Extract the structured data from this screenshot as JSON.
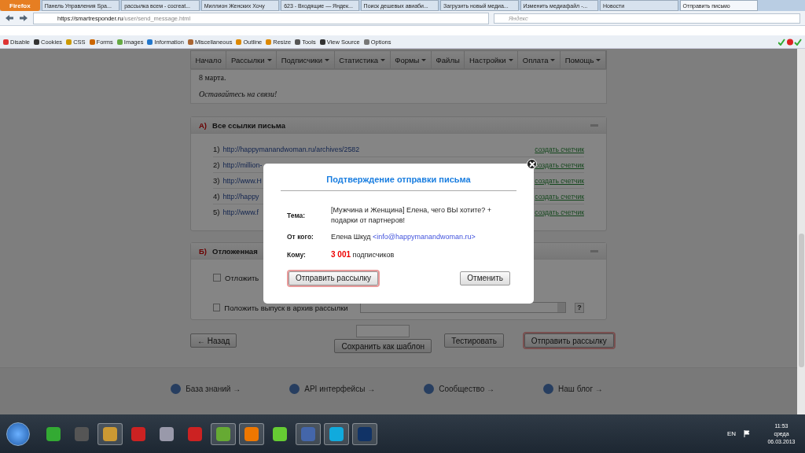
{
  "browser": {
    "menu_button": "Firefox",
    "tabs": [
      {
        "label": "Панель Управления Spa...",
        "selected": false
      },
      {
        "label": "рассылка всем - cocreat...",
        "selected": false
      },
      {
        "label": "Миллион Женских Хочу",
        "selected": false
      },
      {
        "label": "623 - Входящие — Яндек...",
        "selected": false
      },
      {
        "label": "Поиск дешевых авиаби...",
        "selected": false
      },
      {
        "label": "Загрузить новый медиа...",
        "selected": false
      },
      {
        "label": "Изменить медиафайл -...",
        "selected": false
      },
      {
        "label": "Новости",
        "selected": false
      },
      {
        "label": "Отправить письмо",
        "selected": true
      }
    ],
    "url_host": "https://smartresponder.ru",
    "url_path": "/user/send_message.html",
    "search": {
      "placeholder": "Яндекс"
    },
    "toolbar": [
      "Disable",
      "Cookies",
      "CSS",
      "Forms",
      "Images",
      "Information",
      "Miscellaneous",
      "Outline",
      "Resize",
      "Tools",
      "View Source",
      "Options"
    ]
  },
  "nav": [
    {
      "label": "Начало",
      "has_menu": false
    },
    {
      "label": "Рассылки",
      "has_menu": true
    },
    {
      "label": "Подписчики",
      "has_menu": true
    },
    {
      "label": "Статистика",
      "has_menu": true
    },
    {
      "label": "Формы",
      "has_menu": true
    },
    {
      "label": "Файлы",
      "has_menu": false
    },
    {
      "label": "Настройки",
      "has_menu": true
    },
    {
      "label": "Оплата",
      "has_menu": true
    },
    {
      "label": "Помощь",
      "has_menu": true
    }
  ],
  "message_tail": [
    "8 марта.",
    "Оставайтесь на связи!"
  ],
  "links_section": {
    "letter": "А)",
    "title": "Все ссылки письма",
    "links": [
      {
        "num": "1)",
        "url": "http://happymanandwoman.ru/archives/2582",
        "action": "создать счетчик"
      },
      {
        "num": "2)",
        "url": "http://million-",
        "action": "создать счетчик"
      },
      {
        "num": "3)",
        "url": "http://www.H",
        "action": "создать счетчик"
      },
      {
        "num": "4)",
        "url": "http://happy",
        "action": "создать счетчик"
      },
      {
        "num": "5)",
        "url": "http://www.f",
        "action": "создать счетчик"
      }
    ]
  },
  "delay_section": {
    "letter": "Б)",
    "title": "Отложенная",
    "options": [
      {
        "label": "Отложить",
        "checked": false
      },
      {
        "label": "Положить выпуск в архив рассылки",
        "checked": false
      }
    ],
    "help": "?"
  },
  "buttons": {
    "back": "← Назад",
    "test": "Тестировать",
    "send": "Отправить рассылку",
    "save_template": "Сохранить как шаблон"
  },
  "footer": [
    "База знаний →",
    "API интерфейсы →",
    "Сообщество →",
    "Наш блог →"
  ],
  "dialog": {
    "title": "Подтверждение отправки письма",
    "subject_label": "Тема:",
    "subject": "[Мужчина и Женщина] Елена, чего ВЫ хотите? + подарки от партнеров!",
    "from_label": "От кого:",
    "from_name": "Елена Шкуд",
    "from_email": "<info@happymanandwoman.ru>",
    "to_label": "Кому:",
    "to_count": "3 001",
    "to_unit": "подписчиков",
    "send": "Отправить рассылку",
    "cancel": "Отменить"
  },
  "taskbar": {
    "language": "EN",
    "time": "11:53",
    "weekday": "среда",
    "date": "06.03.2013"
  }
}
